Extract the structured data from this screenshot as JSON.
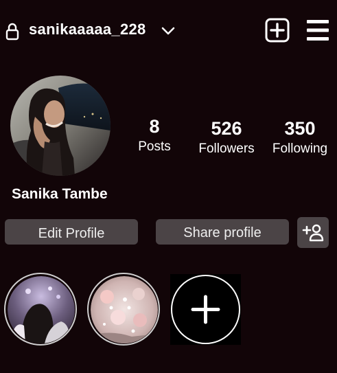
{
  "header": {
    "username": "sanikaaaaa_228",
    "icons": [
      "lock-icon",
      "chevron-down-icon",
      "create-post-icon",
      "menu-icon"
    ]
  },
  "profile": {
    "full_name": "Sanika Tambe",
    "stats": {
      "posts": {
        "value": "8",
        "label": "Posts"
      },
      "followers": {
        "value": "526",
        "label": "Followers"
      },
      "following": {
        "value": "350",
        "label": "Following"
      }
    }
  },
  "actions": {
    "edit_profile": "Edit Profile",
    "share_profile": "Share profile",
    "add_user_icon": "add-user-icon"
  },
  "highlights": {
    "count_shown": 2,
    "new_icon": "plus-icon"
  },
  "colors": {
    "background": "#120508",
    "button": "#4b4446",
    "text": "#ffffff"
  }
}
